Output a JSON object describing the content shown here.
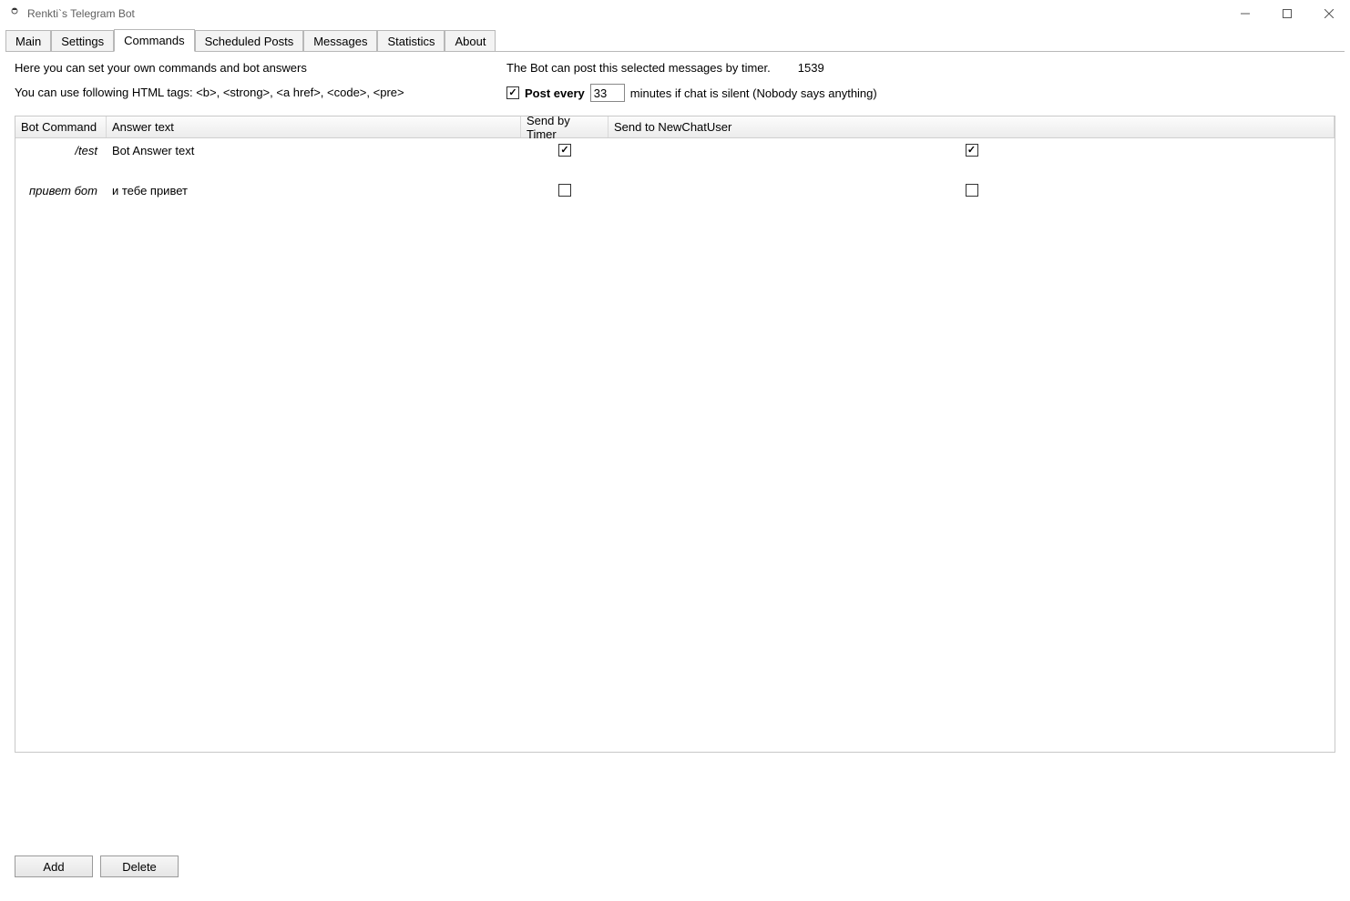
{
  "window": {
    "title": "Renkti`s Telegram Bot"
  },
  "tabs": [
    "Main",
    "Settings",
    "Commands",
    "Scheduled Posts",
    "Messages",
    "Statistics",
    "About"
  ],
  "active_tab": "Commands",
  "instructions": {
    "line1": "Here you can set your own commands and bot answers",
    "line2": "You can use following HTML tags:   <b>, <strong>, <a href>, <code>, <pre>"
  },
  "timer_section": {
    "description": "The Bot can post this selected messages by timer.",
    "counter": "1539",
    "post_every_checked": true,
    "post_every_label": "Post every",
    "post_every_value": "33",
    "post_every_suffix": "minutes if chat is silent (Nobody says anything)"
  },
  "table": {
    "headers": {
      "command": "Bot Command",
      "answer": "Answer text",
      "timer": "Send by Timer",
      "newuser": "Send to NewChatUser"
    },
    "rows": [
      {
        "command": "/test",
        "answer": "Bot Answer text",
        "send_by_timer": true,
        "send_to_newuser": true
      },
      {
        "command": "привет бот",
        "answer": "и тебе привет",
        "send_by_timer": false,
        "send_to_newuser": false
      }
    ]
  },
  "buttons": {
    "add": "Add",
    "delete": "Delete"
  }
}
